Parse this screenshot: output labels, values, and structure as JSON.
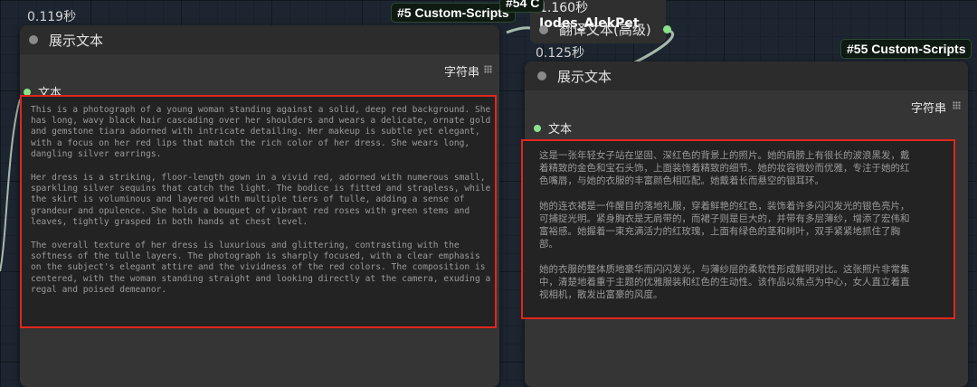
{
  "left_node": {
    "exec_time": "0.119秒",
    "title": "展示文本",
    "badge": "#5 Custom-Scripts",
    "output_label": "字符串",
    "input_label": "文本",
    "text_paragraphs": [
      "This is a photograph of a young woman standing against a solid, deep red background. She\nhas long, wavy black hair cascading over her shoulders and wears a delicate, ornate gold\nand gemstone tiara adorned with intricate detailing. Her makeup is subtle yet elegant,\nwith a focus on her red lips that match the rich color of her dress. She wears long,\ndangling silver earrings.",
      "Her dress is a striking, floor-length gown in a vivid red, adorned with numerous small,\nsparkling silver sequins that catch the light. The bodice is fitted and strapless, while\nthe skirt is voluminous and layered with multiple tiers of tulle, adding a sense of\ngrandeur and opulence. She holds a bouquet of vibrant red roses with green stems and\nleaves, tightly grasped in both hands at chest level.",
      "The overall texture of her dress is luxurious and glittering, contrasting with the\nsoftness of the tulle layers. The photograph is sharply focused, with a clear emphasis\non the subject's elegant attire and the vividness of the red colors. The composition is\ncentered, with the woman standing straight and looking directly at the camera, exuding a\nregal and poised demeanor."
    ]
  },
  "middle_node": {
    "exec_time": "1.160秒",
    "header_fragment": "Iodes_AlekPet",
    "title": "翻译文本(高级)",
    "badge": "#54 C"
  },
  "right_node": {
    "exec_time": "0.125秒",
    "title": "展示文本",
    "badge": "#55 Custom-Scripts",
    "output_label": "字符串",
    "input_label": "文本",
    "text_paragraphs": [
      "这是一张年轻女子站在坚固、深红色的背景上的照片。她的肩膀上有很长的波浪黑发，戴\n着精致的金色和宝石头饰，上面装饰着精致的细节。她的妆容微妙而优雅，专注于她的红\n色嘴唇，与她的衣服的丰富颜色相匹配。她戴着长而悬空的银耳环。",
      "她的连衣裙是一件醒目的落地礼服，穿着鲜艳的红色，装饰着许多闪闪发光的银色亮片，\n可捕捉光明。紧身胸衣是无肩带的，而裙子则是巨大的，并带有多层薄纱，增添了宏伟和\n富裕感。她握着一束充满活力的红玫瑰，上面有绿色的茎和树叶，双手紧紧地抓住了胸\n部。",
      "她的衣服的整体质地豪华而闪闪发光，与薄纱层的柔软性形成鲜明对比。这张照片非常集\n中，清楚地着重于主题的优雅服装和红色的生动性。该作品以焦点为中心，女人直立着直\n视相机，散发出富豪的风度。"
    ]
  },
  "colors": {
    "canvas": "#1d2530",
    "node_body": "#353535",
    "node_header": "#2c2c2c",
    "highlight_border": "#e1261c",
    "input_dot": "#8be28b"
  }
}
